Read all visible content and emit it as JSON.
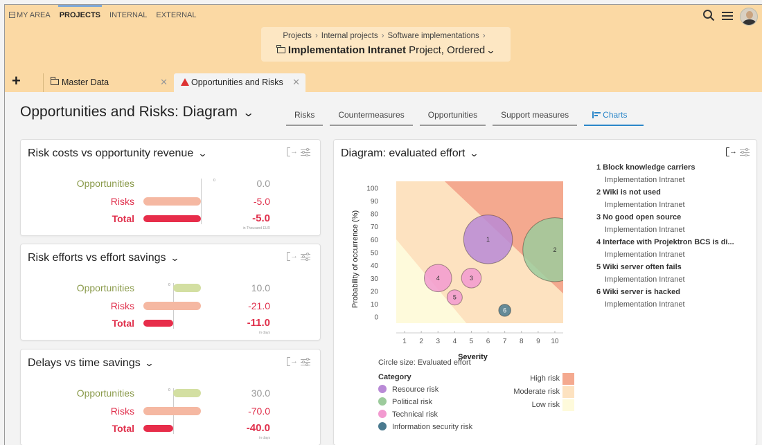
{
  "topnav": {
    "my_area": "MY AREA",
    "projects": "PROJECTS",
    "internal": "INTERNAL",
    "external": "EXTERNAL"
  },
  "breadcrumb": {
    "items": [
      "Projects",
      "Internal projects",
      "Software implementations"
    ],
    "separator": "›",
    "title": "Implementation Intranet",
    "subtitle": "Project, Ordered"
  },
  "tabs": {
    "master_data": "Master Data",
    "opportunities": "Opportunities and Risks"
  },
  "page": {
    "title": "Opportunities and Risks: Diagram"
  },
  "subtabs": {
    "risks": "Risks",
    "countermeasures": "Countermeasures",
    "opportunities": "Opportunities",
    "support": "Support measures",
    "charts": "Charts"
  },
  "cards": [
    {
      "title": "Risk costs vs opportunity revenue",
      "labels": [
        "Opportunities",
        "Risks",
        "Total"
      ],
      "values": [
        "0.0",
        "-5.0",
        "-5.0"
      ],
      "unit": "in Thousand EUR",
      "zero": "0",
      "bars": [
        0.0,
        -5.0,
        -5.0
      ]
    },
    {
      "title": "Risk efforts vs effort savings",
      "labels": [
        "Opportunities",
        "Risks",
        "Total"
      ],
      "values": [
        "10.0",
        "-21.0",
        "-11.0"
      ],
      "unit": "in days",
      "zero": "0",
      "bars": [
        10.0,
        -21.0,
        -11.0
      ]
    },
    {
      "title": "Delays vs time savings",
      "labels": [
        "Opportunities",
        "Risks",
        "Total"
      ],
      "values": [
        "30.0",
        "-70.0",
        "-40.0"
      ],
      "unit": "in days",
      "zero": "0",
      "bars": [
        30.0,
        -70.0,
        -40.0
      ]
    }
  ],
  "diagram": {
    "title": "Diagram: evaluated effort",
    "items": [
      {
        "title": "1 Block knowledge carriers",
        "sub": "Implementation Intranet"
      },
      {
        "title": "2 Wiki is not used",
        "sub": "Implementation Intranet"
      },
      {
        "title": "3 No good open source",
        "sub": "Implementation Intranet"
      },
      {
        "title": "4 Interface with Projektron BCS is di...",
        "sub": "Implementation Intranet"
      },
      {
        "title": "5 Wiki server often fails",
        "sub": "Implementation Intranet"
      },
      {
        "title": "6 Wiki server is hacked",
        "sub": "Implementation Intranet"
      }
    ],
    "circle_note": "Circle size: Evaluated effort",
    "category_title": "Category",
    "categories": [
      {
        "name": "Resource risk",
        "color": "#b98ad6"
      },
      {
        "name": "Political risk",
        "color": "#9ccb9c"
      },
      {
        "name": "Technical risk",
        "color": "#f29ad0"
      },
      {
        "name": "Information security risk",
        "color": "#4a7a8f"
      }
    ],
    "risk_levels": [
      {
        "name": "High risk",
        "color": "#f4a98f"
      },
      {
        "name": "Moderate risk",
        "color": "#fde2c0"
      },
      {
        "name": "Low risk",
        "color": "#fefadb"
      }
    ]
  },
  "chart_data": {
    "type": "scatter",
    "xlabel": "Severity",
    "ylabel": "Probability of occurrence (%)",
    "xlim": [
      0.5,
      10.5
    ],
    "ylim": [
      -5,
      105
    ],
    "xticks": [
      1,
      2,
      3,
      4,
      5,
      6,
      7,
      8,
      9,
      10
    ],
    "yticks": [
      0,
      10,
      20,
      30,
      40,
      50,
      60,
      70,
      80,
      90,
      100
    ],
    "points": [
      {
        "label": "1",
        "x": 6,
        "y": 60,
        "size": 16.0,
        "category": "Resource risk",
        "color": "#b98ad6"
      },
      {
        "label": "2",
        "x": 10,
        "y": 52,
        "size": 21.0,
        "category": "Political risk",
        "color": "#9ccb9c"
      },
      {
        "label": "3",
        "x": 5,
        "y": 30,
        "size": 6.5,
        "category": "Technical risk",
        "color": "#f29ad0"
      },
      {
        "label": "4",
        "x": 3,
        "y": 30,
        "size": 9.0,
        "category": "Technical risk",
        "color": "#f29ad0"
      },
      {
        "label": "5",
        "x": 4,
        "y": 15,
        "size": 5.0,
        "category": "Technical risk",
        "color": "#f29ad0"
      },
      {
        "label": "6",
        "x": 7,
        "y": 5,
        "size": 4.0,
        "category": "Information security risk",
        "color": "#4a7a8f"
      }
    ]
  }
}
